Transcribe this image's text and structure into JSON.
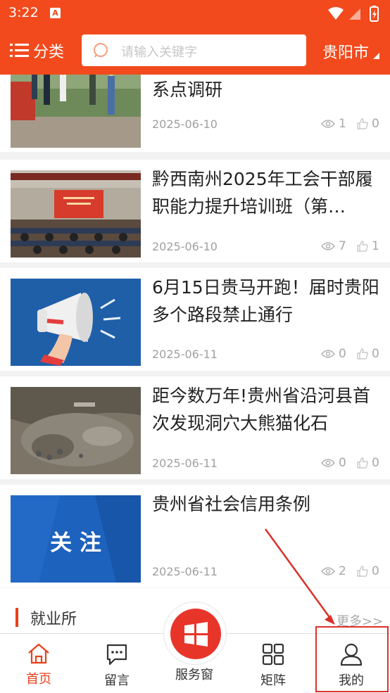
{
  "status_bar": {
    "time": "3:22",
    "notification_icon": "A"
  },
  "header": {
    "category_label": "分类",
    "search_placeholder": "请输入关键字",
    "city": "贵阳市"
  },
  "articles": [
    {
      "title": "省总工会赴织金县乡村振兴联系点调研",
      "date": "2025-06-10",
      "views": "1",
      "likes": "0"
    },
    {
      "title": "黔西南州2025年工会干部履职能力提升培训班（第…",
      "date": "2025-06-10",
      "views": "7",
      "likes": "1"
    },
    {
      "title": "6月15日贵马开跑！届时贵阳多个路段禁止通行",
      "date": "2025-06-11",
      "views": "0",
      "likes": "0"
    },
    {
      "title": "距今数万年!贵州省沿河县首次发现洞穴大熊猫化石",
      "date": "2025-06-11",
      "views": "0",
      "likes": "0"
    },
    {
      "title": "贵州省社会信用条例",
      "date": "2025-06-11",
      "views": "2",
      "likes": "0",
      "thumb_text": "关 注"
    }
  ],
  "section": {
    "name": "就业所",
    "more": "更多>>"
  },
  "tabbar": {
    "home": "首页",
    "message": "留言",
    "service": "服务窗",
    "matrix": "矩阵",
    "mine": "我的"
  },
  "colors": {
    "brand": "#f24a1d",
    "accent": "#e8401c",
    "annotation": "#d9322a"
  }
}
